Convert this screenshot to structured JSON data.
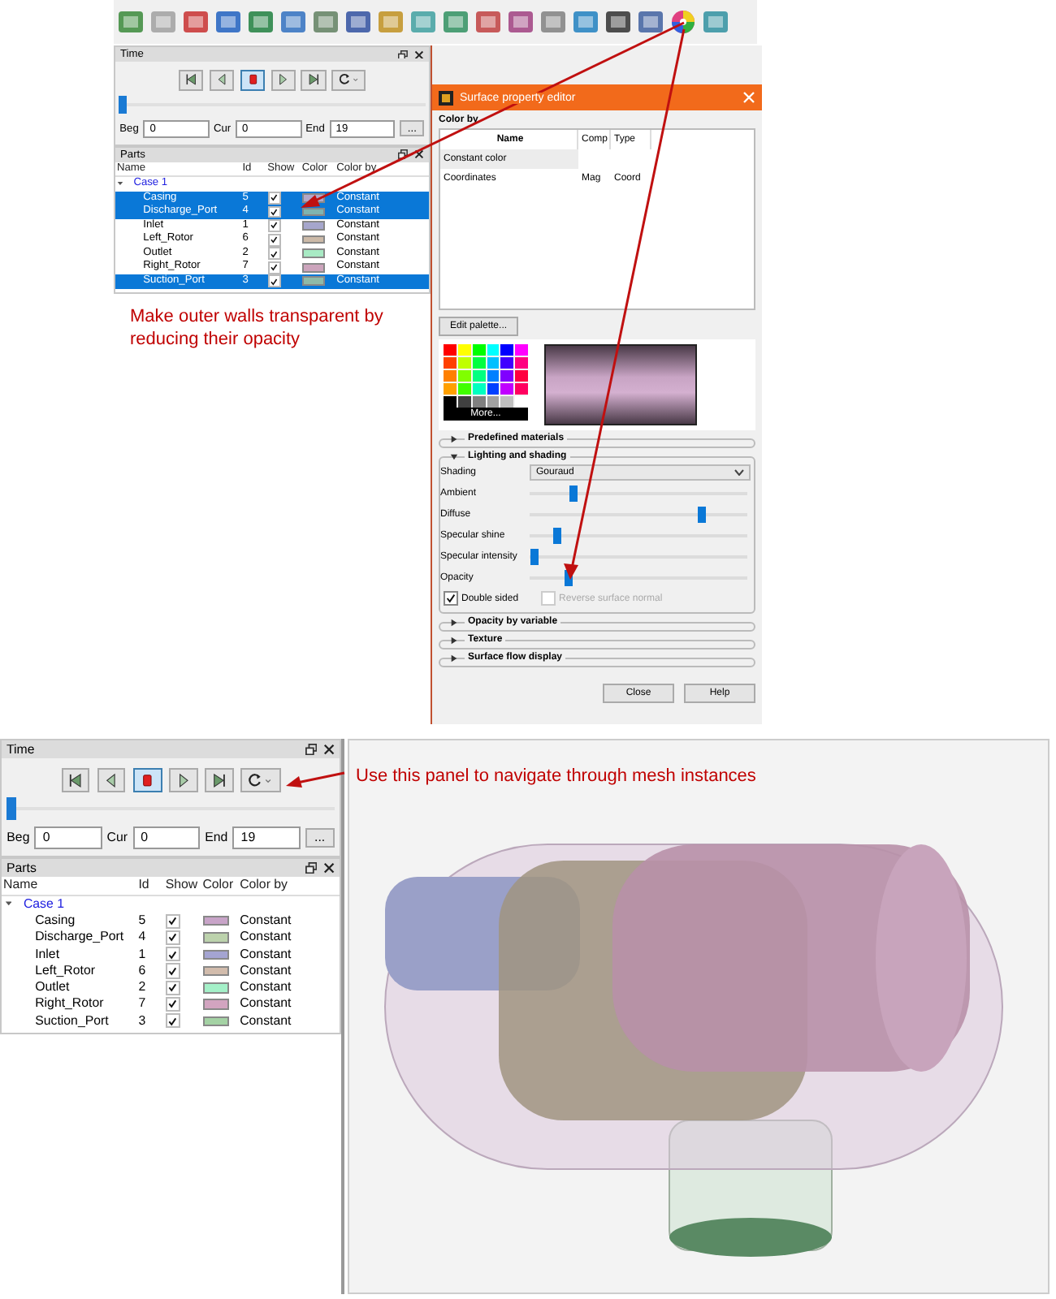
{
  "top_time_panel": {
    "title": "Time",
    "controls": [
      {
        "kind": "first",
        "selected": false
      },
      {
        "kind": "prev",
        "selected": false
      },
      {
        "kind": "stop",
        "selected": true
      },
      {
        "kind": "next",
        "selected": false
      },
      {
        "kind": "last",
        "selected": false
      },
      {
        "kind": "loop",
        "selected": false
      }
    ],
    "slider": {
      "level": 0
    },
    "fields": [
      {
        "label": "Beg",
        "value": "0"
      },
      {
        "label": "Cur",
        "value": "0"
      },
      {
        "label": "End",
        "value": "19"
      }
    ],
    "more_button": "..."
  },
  "top_parts_panel": {
    "title": "Parts",
    "columns": [
      "Name",
      "Id",
      "Show",
      "Color",
      "Color by"
    ],
    "tree": [
      {
        "name": "Case 1",
        "expanded": true,
        "children": [
          {
            "name": "Casing",
            "id": "5",
            "show": true,
            "color": "#b4a6c8",
            "color_by": "Constant",
            "selected": true
          },
          {
            "name": "Discharge_Port",
            "id": "4",
            "show": true,
            "color": "#7fb4b0",
            "color_by": "Constant",
            "selected": true
          },
          {
            "name": "Inlet",
            "id": "1",
            "show": true,
            "color": "#a6a6cc",
            "color_by": "Constant",
            "selected": false
          },
          {
            "name": "Left_Rotor",
            "id": "6",
            "show": true,
            "color": "#ccbaa8",
            "color_by": "Constant",
            "selected": false
          },
          {
            "name": "Outlet",
            "id": "2",
            "show": true,
            "color": "#a8eac4",
            "color_by": "Constant",
            "selected": false
          },
          {
            "name": "Right_Rotor",
            "id": "7",
            "show": true,
            "color": "#cca4bc",
            "color_by": "Constant",
            "selected": false
          },
          {
            "name": "Suction_Port",
            "id": "3",
            "show": true,
            "color": "#8fbaa8",
            "color_by": "Constant",
            "selected": true
          }
        ]
      }
    ]
  },
  "annotations": [
    {
      "text": "Make outer walls transparent by reducing their opacity"
    },
    {
      "text": "Use this panel to navigate through mesh instances"
    }
  ],
  "surface_editor": {
    "title": "Surface property editor",
    "color_by_label": "Color by",
    "table": {
      "columns": [
        "Name",
        "Comp",
        "Type"
      ],
      "rows": [
        {
          "name": "Constant color",
          "selected": true
        },
        {
          "name": "Coordinates",
          "comp": "Mag",
          "type": "Coord",
          "selected": false
        }
      ]
    },
    "edit_palette_button": "Edit palette...",
    "more_button": "More...",
    "sections": [
      {
        "title": "Predefined materials",
        "expanded": false
      },
      {
        "title": "Lighting and shading",
        "expanded": true,
        "shading": {
          "label": "Shading",
          "value": "Gouraud"
        },
        "sliders": [
          {
            "label": "Ambient",
            "level": 0.2
          },
          {
            "label": "Diffuse",
            "level": 0.79
          },
          {
            "label": "Specular shine",
            "level": 0.13
          },
          {
            "label": "Specular intensity",
            "level": 0.02
          },
          {
            "label": "Opacity",
            "level": 0.18
          }
        ],
        "checkboxes": [
          {
            "label": "Double sided",
            "checked": true,
            "disabled": false
          },
          {
            "label": "Reverse surface normal",
            "checked": false,
            "disabled": true
          }
        ]
      },
      {
        "title": "Opacity by variable",
        "expanded": false
      },
      {
        "title": "Texture",
        "expanded": false
      },
      {
        "title": "Surface flow display",
        "expanded": false
      }
    ],
    "buttons": [
      "Close",
      "Help"
    ]
  },
  "bottom_time_panel": {
    "title": "Time",
    "controls": [
      {
        "kind": "first",
        "selected": false
      },
      {
        "kind": "prev",
        "selected": false
      },
      {
        "kind": "stop",
        "selected": true
      },
      {
        "kind": "next",
        "selected": false
      },
      {
        "kind": "last",
        "selected": false
      },
      {
        "kind": "loop",
        "selected": false
      }
    ],
    "slider": {
      "level": 0
    },
    "fields": [
      {
        "label": "Beg",
        "value": "0"
      },
      {
        "label": "Cur",
        "value": "0"
      },
      {
        "label": "End",
        "value": "19"
      }
    ],
    "more_button": "..."
  },
  "bottom_parts_panel": {
    "title": "Parts",
    "columns": [
      "Name",
      "Id",
      "Show",
      "Color",
      "Color by"
    ],
    "tree": [
      {
        "name": "Case 1",
        "expanded": true,
        "children": [
          {
            "name": "Casing",
            "id": "5",
            "show": true,
            "color": "#c8a4c8",
            "color_by": "Constant",
            "selected": false
          },
          {
            "name": "Discharge_Port",
            "id": "4",
            "show": true,
            "color": "#bcd2ac",
            "color_by": "Constant",
            "selected": false
          },
          {
            "name": "Inlet",
            "id": "1",
            "show": true,
            "color": "#a4a4d2",
            "color_by": "Constant",
            "selected": false
          },
          {
            "name": "Left_Rotor",
            "id": "6",
            "show": true,
            "color": "#d2bcac",
            "color_by": "Constant",
            "selected": false
          },
          {
            "name": "Outlet",
            "id": "2",
            "show": true,
            "color": "#a4f0c8",
            "color_by": "Constant",
            "selected": false
          },
          {
            "name": "Right_Rotor",
            "id": "7",
            "show": true,
            "color": "#d2a4c0",
            "color_by": "Constant",
            "selected": false
          },
          {
            "name": "Suction_Port",
            "id": "3",
            "show": true,
            "color": "#a4d2a4",
            "color_by": "Constant",
            "selected": false
          }
        ]
      }
    ]
  }
}
